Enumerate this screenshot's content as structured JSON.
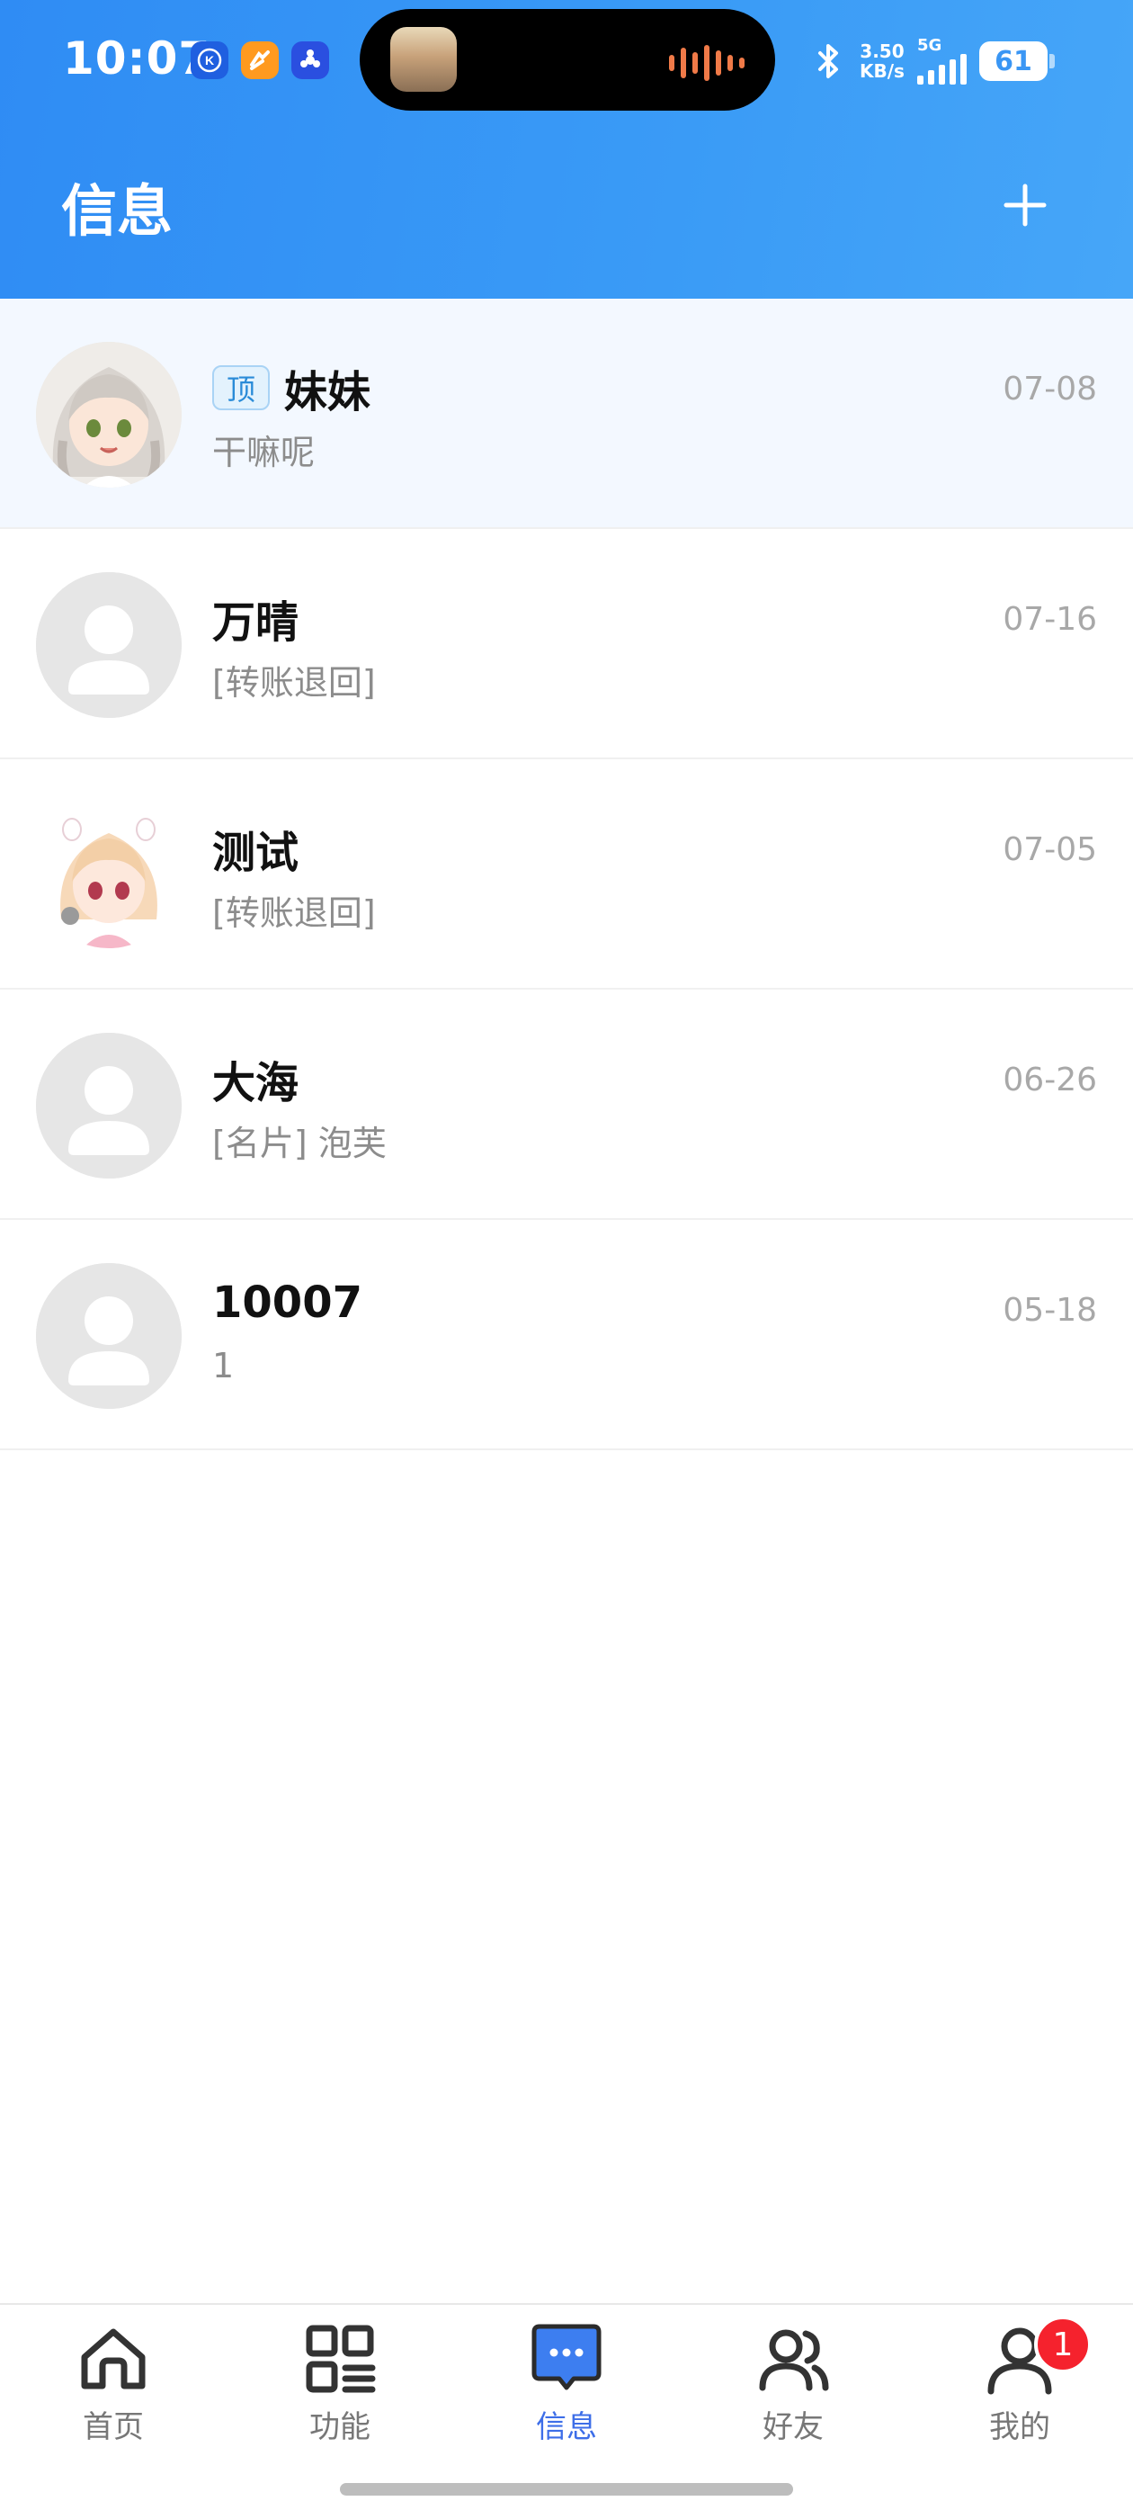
{
  "status_bar": {
    "time": "10:07",
    "network_speed_value": "3.50",
    "network_speed_unit": "KB/s",
    "network_type": "5G",
    "battery": "61"
  },
  "header": {
    "title": "信息",
    "add_icon": "plus-icon"
  },
  "conversations": [
    {
      "name": "妹妹",
      "pinned": true,
      "pin_label": "顶",
      "preview": "干嘛呢",
      "date": "07-08",
      "avatar": "anime-girl-silver-hair"
    },
    {
      "name": "万晴",
      "pinned": false,
      "preview": "[转账退回]",
      "date": "07-16",
      "avatar": "default-avatar"
    },
    {
      "name": "测试",
      "pinned": false,
      "preview": "[转账退回]",
      "date": "07-05",
      "avatar": "anime-girl-pink-hair"
    },
    {
      "name": "大海",
      "pinned": false,
      "preview": "[名片] 泡芙",
      "date": "06-26",
      "avatar": "default-avatar"
    },
    {
      "name": "10007",
      "pinned": false,
      "preview": "1",
      "date": "05-18",
      "avatar": "default-avatar"
    }
  ],
  "bottom_nav": {
    "items": [
      {
        "label": "首页",
        "icon": "home-icon"
      },
      {
        "label": "功能",
        "icon": "grid-icon"
      },
      {
        "label": "信息",
        "icon": "message-icon",
        "active": true
      },
      {
        "label": "好友",
        "icon": "friends-icon"
      },
      {
        "label": "我的",
        "icon": "profile-icon",
        "badge": "1"
      }
    ]
  },
  "colors": {
    "header_bg": "#3a9bf6",
    "active_nav": "#3d6ee8",
    "badge": "#f5222d",
    "pinned_row_bg": "#f3f8ff"
  }
}
